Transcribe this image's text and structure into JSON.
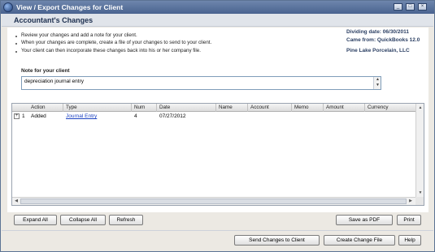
{
  "window": {
    "title": "View / Export Changes for Client",
    "controls": [
      "_",
      "□",
      "×"
    ]
  },
  "header": {
    "title": "Accountant's Changes"
  },
  "instructions": [
    "Review your changes and add a note for your client.",
    "When your changes are complete, create a file of your changes to send to your client.",
    "Your client can then incorporate these changes back into his or her company file."
  ],
  "info": {
    "dividing_date": "Dividing date: 06/30/2011",
    "came_from": "Came from: QuickBooks 12.0",
    "company": "Pine Lake Porcelain, LLC"
  },
  "note": {
    "label": "Note for your client",
    "value": "depreciation journal entry"
  },
  "grid": {
    "columns": [
      "Action",
      "Type",
      "Num",
      "Date",
      "Name",
      "Account",
      "Memo",
      "Amount",
      "Currency"
    ],
    "rows": [
      {
        "index": "1",
        "action": "Added",
        "type": "Journal Entry",
        "num": "4",
        "date": "07/27/2012",
        "name": "",
        "account": "",
        "memo": "",
        "amount": "",
        "currency": ""
      }
    ]
  },
  "buttons": {
    "expand_all": "Expand All",
    "collapse_all": "Collapse All",
    "refresh": "Refresh",
    "save_pdf": "Save as PDF",
    "print": "Print",
    "send_changes": "Send Changes to Client",
    "create_file": "Create Change File",
    "help": "Help"
  },
  "colors": {
    "titlebar": "#49638f",
    "link": "#1d43c2",
    "info_text": "#2b3f63"
  }
}
